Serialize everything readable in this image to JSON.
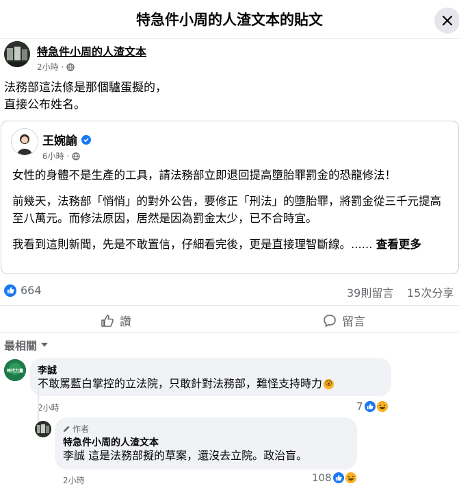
{
  "dialog": {
    "title": "特急件小周的人渣文本的貼文"
  },
  "post": {
    "author": "特急件小周的人渣文本",
    "time": "2小時",
    "separator": "·",
    "text_line1": "法務部這法條是那個驢蛋擬的，",
    "text_line2": "直接公布姓名。"
  },
  "shared_post": {
    "author": "王婉諭",
    "time": "6小時",
    "separator": "·",
    "para1": "女性的身體不是生產的工具，請法務部立即退回提高墮胎罪罰金的恐龍修法！",
    "para2": "前幾天，法務部「悄悄」的對外公告，要修正「刑法」的墮胎罪，將罰金從三千元提高至八萬元。而修法原因，居然是因為罰金太少，已不合時宜。",
    "para3": "我看到這則新聞，先是不敢置信，仔細看完後，更是直接理智斷線。......",
    "see_more": "查看更多"
  },
  "stats": {
    "likes": "664",
    "comments": "39則留言",
    "shares": "15次分享"
  },
  "actions": {
    "like": "讚",
    "comment": "留言"
  },
  "sort_label": "最相關",
  "comments": [
    {
      "author": "李誠",
      "avatar_text": "時代力量",
      "text": "不敢罵藍白掌控的立法院，只敢針對法務部，難怪支持時力",
      "emoji_inline": "😮",
      "time": "2小時",
      "reactions": "7"
    }
  ],
  "reply": {
    "badge": "作者",
    "author": "特急件小周的人渣文本",
    "text": "李誠 這是法務部擬的草案，還沒去立院。政治盲。",
    "time": "2小時",
    "reactions": "108"
  },
  "colors": {
    "accent": "#1877f2",
    "secondary_text": "#65676b",
    "bubble": "#f0f2f5"
  }
}
